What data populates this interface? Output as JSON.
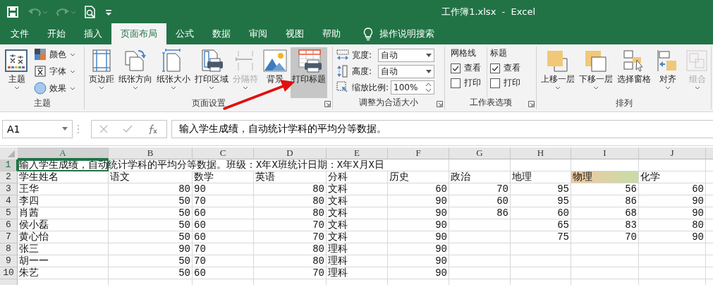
{
  "title_bar": {
    "title": "工作簿1.xlsx  -  Excel"
  },
  "menu_tabs": [
    {
      "label": "文件",
      "selected": false
    },
    {
      "label": "开始",
      "selected": false
    },
    {
      "label": "插入",
      "selected": false
    },
    {
      "label": "页面布局",
      "selected": true
    },
    {
      "label": "公式",
      "selected": false
    },
    {
      "label": "数据",
      "selected": false
    },
    {
      "label": "审阅",
      "selected": false
    },
    {
      "label": "视图",
      "selected": false
    },
    {
      "label": "帮助",
      "selected": false
    }
  ],
  "tell_me": {
    "label": "操作说明搜索"
  },
  "ribbon_groups": [
    {
      "label": "主题",
      "launcher": false,
      "items": [
        {
          "kind": "large",
          "label": "主题",
          "dropdown": true,
          "disabled": false,
          "highlighted": false
        },
        {
          "kind": "small",
          "label": "颜色"
        },
        {
          "kind": "small",
          "label": "字体"
        },
        {
          "kind": "small",
          "label": "效果"
        }
      ]
    },
    {
      "label": "页面设置",
      "launcher": true,
      "items": [
        {
          "kind": "large",
          "label": "页边距",
          "dropdown": true,
          "disabled": false,
          "highlighted": false
        },
        {
          "kind": "large",
          "label": "纸张方向",
          "dropdown": true,
          "disabled": false,
          "highlighted": false
        },
        {
          "kind": "large",
          "label": "纸张大小",
          "dropdown": true,
          "disabled": false,
          "highlighted": false
        },
        {
          "kind": "large",
          "label": "打印区域",
          "dropdown": true,
          "disabled": false,
          "highlighted": false
        },
        {
          "kind": "large",
          "label": "分隔符",
          "dropdown": true,
          "disabled": true,
          "highlighted": false
        },
        {
          "kind": "large",
          "label": "背景",
          "dropdown": false,
          "disabled": false,
          "highlighted": false
        },
        {
          "kind": "large",
          "label": "打印标题",
          "dropdown": false,
          "disabled": false,
          "highlighted": true
        }
      ]
    },
    {
      "label": "调整为合适大小",
      "launcher": true,
      "items": [
        {
          "kind": "dropdown-field",
          "label": "宽度:",
          "value": "自动"
        },
        {
          "kind": "dropdown-field",
          "label": "高度:",
          "value": "自动"
        },
        {
          "kind": "spin-field",
          "label": "缩放比例:",
          "value": "100%"
        }
      ]
    },
    {
      "label": "工作表选项",
      "launcher": true,
      "items": [
        {
          "kind": "check-column",
          "label": "网格线",
          "options": [
            {
              "label": "查看",
              "checked": true
            },
            {
              "label": "打印",
              "checked": false
            }
          ]
        },
        {
          "kind": "check-column",
          "label": "标题",
          "options": [
            {
              "label": "查看",
              "checked": true
            },
            {
              "label": "打印",
              "checked": false
            }
          ]
        }
      ]
    },
    {
      "label": "排列",
      "launcher": false,
      "items": [
        {
          "kind": "large",
          "label": "上移一层",
          "dropdown": true,
          "disabled": false,
          "highlighted": false
        },
        {
          "kind": "large",
          "label": "下移一层",
          "dropdown": true,
          "disabled": false,
          "highlighted": false
        },
        {
          "kind": "large",
          "label": "选择窗格",
          "dropdown": false,
          "disabled": false,
          "highlighted": false
        },
        {
          "kind": "large",
          "label": "对齐",
          "dropdown": true,
          "disabled": false,
          "highlighted": false
        },
        {
          "kind": "large",
          "label": "组合",
          "dropdown": true,
          "disabled": true,
          "highlighted": false
        }
      ]
    }
  ],
  "formula_bar": {
    "name_box": "A1",
    "formula": "输入学生成绩，自动统计学科的平均分等数据。"
  },
  "sheet": {
    "columns": [
      {
        "label": "A",
        "selected": true
      },
      {
        "label": "B",
        "selected": false
      },
      {
        "label": "C",
        "selected": false
      },
      {
        "label": "D",
        "selected": false
      },
      {
        "label": "E",
        "selected": false
      },
      {
        "label": "F",
        "selected": false
      },
      {
        "label": "G",
        "selected": false
      },
      {
        "label": "H",
        "selected": false
      },
      {
        "label": "I",
        "selected": false
      },
      {
        "label": "J",
        "selected": false
      }
    ],
    "rows": [
      {
        "label": "1",
        "selected": true,
        "cells": [
          {
            "kind": "text",
            "text": "输入学生成绩，自动统计学科的平均分等数据。班级：X年X班统计日期：X年X月X日"
          }
        ]
      },
      {
        "label": "2",
        "selected": false,
        "cells": [
          {
            "kind": "text",
            "text": "学生姓名"
          },
          {
            "kind": "text",
            "text": "语文"
          },
          {
            "kind": "text",
            "text": "数学"
          },
          {
            "kind": "text",
            "text": "英语"
          },
          {
            "kind": "text",
            "text": "分科"
          },
          {
            "kind": "text",
            "text": "历史"
          },
          {
            "kind": "text",
            "text": "政治"
          },
          {
            "kind": "text",
            "text": "地理"
          },
          {
            "kind": "text",
            "text": "物理",
            "highlight": true
          },
          {
            "kind": "text",
            "text": "化学"
          }
        ]
      },
      {
        "label": "3",
        "selected": false,
        "cells": [
          {
            "kind": "text",
            "text": "王华"
          },
          {
            "kind": "number",
            "text": "80"
          },
          {
            "kind": "text",
            "text": "90"
          },
          {
            "kind": "number",
            "text": "80"
          },
          {
            "kind": "text",
            "text": "文科"
          },
          {
            "kind": "number",
            "text": "60"
          },
          {
            "kind": "number",
            "text": "70"
          },
          {
            "kind": "number",
            "text": "95"
          },
          {
            "kind": "number",
            "text": "56"
          },
          {
            "kind": "number",
            "text": "60"
          }
        ]
      },
      {
        "label": "4",
        "selected": false,
        "cells": [
          {
            "kind": "text",
            "text": "李四"
          },
          {
            "kind": "number",
            "text": "50"
          },
          {
            "kind": "text",
            "text": "70"
          },
          {
            "kind": "number",
            "text": "80"
          },
          {
            "kind": "text",
            "text": "文科"
          },
          {
            "kind": "number",
            "text": "90"
          },
          {
            "kind": "number",
            "text": "60"
          },
          {
            "kind": "number",
            "text": "95"
          },
          {
            "kind": "number",
            "text": "86"
          },
          {
            "kind": "number",
            "text": "90"
          }
        ]
      },
      {
        "label": "5",
        "selected": false,
        "cells": [
          {
            "kind": "text",
            "text": "肖茜"
          },
          {
            "kind": "number",
            "text": "50"
          },
          {
            "kind": "text",
            "text": "60"
          },
          {
            "kind": "number",
            "text": "80"
          },
          {
            "kind": "text",
            "text": "文科"
          },
          {
            "kind": "number",
            "text": "90"
          },
          {
            "kind": "number",
            "text": "86"
          },
          {
            "kind": "number",
            "text": "60"
          },
          {
            "kind": "number",
            "text": "68"
          },
          {
            "kind": "number",
            "text": "90"
          }
        ]
      },
      {
        "label": "6",
        "selected": false,
        "cells": [
          {
            "kind": "text",
            "text": "侯小磊"
          },
          {
            "kind": "number",
            "text": "50"
          },
          {
            "kind": "text",
            "text": "60"
          },
          {
            "kind": "number",
            "text": "70"
          },
          {
            "kind": "text",
            "text": "文科"
          },
          {
            "kind": "number",
            "text": "90"
          },
          null,
          {
            "kind": "number",
            "text": "65"
          },
          {
            "kind": "number",
            "text": "83"
          },
          {
            "kind": "number",
            "text": "80"
          }
        ]
      },
      {
        "label": "7",
        "selected": false,
        "cells": [
          {
            "kind": "text",
            "text": "黄心怡"
          },
          {
            "kind": "number",
            "text": "50"
          },
          {
            "kind": "text",
            "text": "60"
          },
          {
            "kind": "number",
            "text": "70"
          },
          {
            "kind": "text",
            "text": "文科"
          },
          {
            "kind": "number",
            "text": "90"
          },
          null,
          {
            "kind": "number",
            "text": "75"
          },
          {
            "kind": "number",
            "text": "70"
          },
          {
            "kind": "number",
            "text": "90"
          }
        ]
      },
      {
        "label": "8",
        "selected": false,
        "cells": [
          {
            "kind": "text",
            "text": "张三"
          },
          {
            "kind": "number",
            "text": "90"
          },
          {
            "kind": "text",
            "text": "70"
          },
          {
            "kind": "number",
            "text": "80"
          },
          {
            "kind": "text",
            "text": "理科"
          },
          {
            "kind": "number",
            "text": "90"
          }
        ]
      },
      {
        "label": "9",
        "selected": false,
        "cells": [
          {
            "kind": "text",
            "text": "胡一一"
          },
          {
            "kind": "number",
            "text": "50"
          },
          {
            "kind": "text",
            "text": "70"
          },
          {
            "kind": "number",
            "text": "80"
          },
          {
            "kind": "text",
            "text": "理科"
          },
          {
            "kind": "number",
            "text": "90"
          }
        ]
      },
      {
        "label": "10",
        "selected": false,
        "cells": [
          {
            "kind": "text",
            "text": "朱艺"
          },
          {
            "kind": "number",
            "text": "50"
          },
          {
            "kind": "text",
            "text": "60"
          },
          {
            "kind": "number",
            "text": "70"
          },
          {
            "kind": "text",
            "text": "理科"
          },
          {
            "kind": "number",
            "text": "90"
          }
        ]
      }
    ]
  }
}
